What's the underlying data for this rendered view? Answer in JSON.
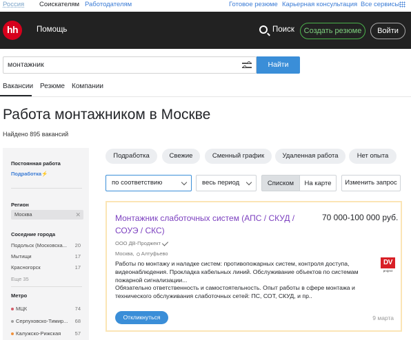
{
  "topbar": {
    "region": "Россия",
    "seekers": "Соискателям",
    "employers": "Работодателям",
    "ready_resume": "Готовое резюме",
    "career": "Карьерная консультация",
    "all_services": "Все сервисы"
  },
  "header": {
    "logo": "hh",
    "help": "Помощь",
    "search": "Поиск",
    "create_resume": "Создать резюме",
    "login": "Войти"
  },
  "search": {
    "value": "монтажник",
    "button": "Найти"
  },
  "tabs": [
    "Вакансии",
    "Резюме",
    "Компании"
  ],
  "page": {
    "title": "Работа монтажником в Москве",
    "found": "Найдено 895 вакансий"
  },
  "sidebar": {
    "permanent_heading": "Постоянная работа",
    "permanent_link": "Подработка⚡",
    "region_heading": "Регион",
    "region_chip": "Москва",
    "nearby_heading": "Соседние города",
    "nearby": [
      {
        "name": "Подольск (Московска...",
        "count": "20"
      },
      {
        "name": "Мытищи",
        "count": "17"
      },
      {
        "name": "Красногорск",
        "count": "17"
      }
    ],
    "more": "Еще 35",
    "metro_heading": "Метро",
    "metro": [
      {
        "name": "МЦК",
        "count": "74",
        "color": "#d35b68"
      },
      {
        "name": "Серпуховско-Тимир...",
        "count": "68",
        "color": "#a0a0a0"
      },
      {
        "name": "Калужско-Рижская",
        "count": "57",
        "color": "#f0913b"
      }
    ]
  },
  "chips": [
    "Подработка",
    "Свежие",
    "Сменный график",
    "Удаленная работа",
    "Нет опыта"
  ],
  "sort": {
    "order": "по соответствию",
    "period": "весь период",
    "list": "Списком",
    "map": "На карте",
    "change": "Изменить запрос"
  },
  "vacancy": {
    "title": "Монтажник слаботочных систем (АПС / СКУД / СОУЭ / СКС)",
    "salary": "70 000-100 000 руб.",
    "company": "ООО ДВ-Проджект",
    "location": "Москва,",
    "metro": "Алтуфьево",
    "description_1": "Работы по монтажу и наладке систем: противопожарных систем, контроля доступа, видеонаблюдения. Прокладка кабельных линий. Обслуживание объектов по системам пожарной сигнализации...",
    "description_2": "Обязательно ответственность и самостоятельность. Опыт работы в сфере монтажа и технического обслуживания слаботочных сетей: ПС, СОТ, СКУД, и пр..",
    "logo_text": "DV",
    "logo_sub": "project",
    "respond": "Откликнуться",
    "date": "9 марта"
  },
  "colors": {
    "accent": "#3a8ed8",
    "brand": "#d6001c",
    "vacancy_title": "#7b3fbf",
    "create_button": "#4bb34b"
  }
}
